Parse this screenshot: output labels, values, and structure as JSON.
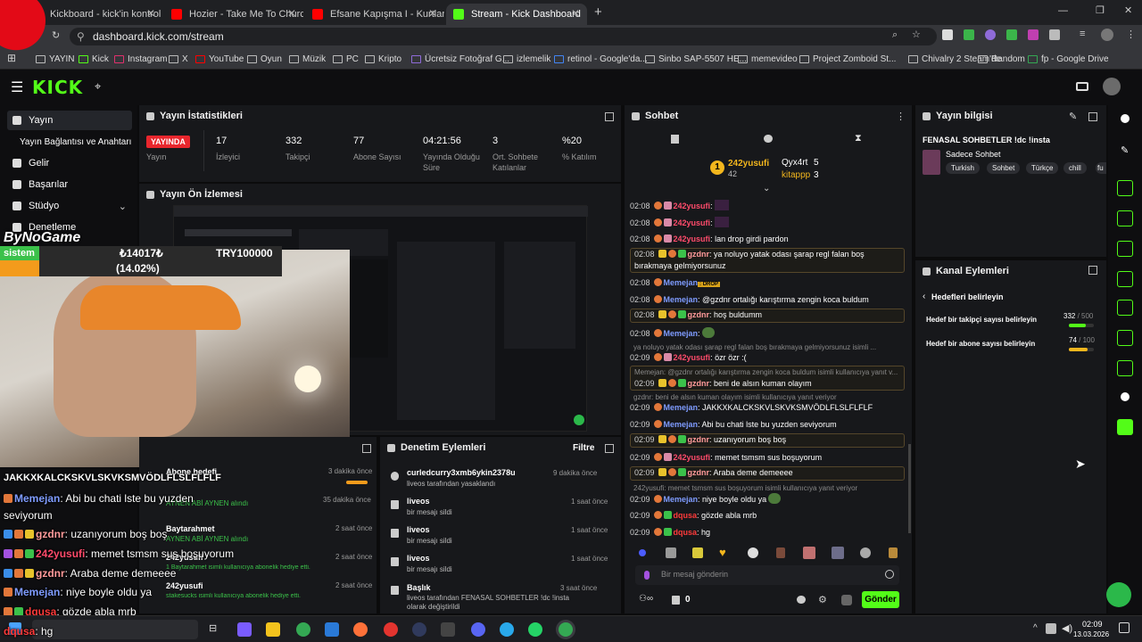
{
  "browser": {
    "tabs": [
      {
        "label": "Kickboard - kick'in kontrol pane",
        "color": "#53fc18"
      },
      {
        "label": "Hozier - Take Me To Church",
        "color": "#ff0000"
      },
      {
        "label": "Efsane Kapışma I - Kurtlar Vadisi",
        "color": "#ff0000"
      },
      {
        "label": "Stream - Kick Dashboard",
        "color": "#53fc18"
      }
    ],
    "url": "dashboard.kick.com/stream",
    "bookmarks": [
      "YAYIN",
      "Kick",
      "Instagram",
      "X",
      "YouTube",
      "Oyun",
      "Müzik",
      "PC",
      "Kripto",
      "Ücretsiz Fotoğraf G...",
      "izlemelik",
      "retinol - Google'da...",
      "Sinbo SAP-5507 HE...",
      "memevideo",
      "Project Zomboid St...",
      "Chivalry 2 Steam'de",
      "Random",
      "fp - Google Drive"
    ]
  },
  "app": {
    "logo": "KICK"
  },
  "sidebar": {
    "items": [
      {
        "label": "Yayın"
      },
      {
        "label": "Yayın Bağlantısı ve Anahtarı"
      },
      {
        "label": "Gelir"
      },
      {
        "label": "Başarılar"
      },
      {
        "label": "Stüdyo"
      },
      {
        "label": "Denetleme"
      }
    ]
  },
  "stats": {
    "title": "Yayın İstatistikleri",
    "live_badge": "YAYINDA",
    "live_label": "Yayın",
    "items": [
      {
        "value": "17",
        "label": "İzleyici"
      },
      {
        "value": "332",
        "label": "Takipçi"
      },
      {
        "value": "77",
        "label": "Abone Sayısı"
      },
      {
        "value": "04:21:56",
        "label": "Yayında Olduğu Süre"
      },
      {
        "value": "3",
        "label": "Ort. Sohbete Katılanlar"
      },
      {
        "value": "%20",
        "label": "% Katılım"
      }
    ]
  },
  "preview": {
    "title": "Yayın Ön İzlemesi"
  },
  "overlay": {
    "brand": "ByNoGame",
    "goal_label": "sistem",
    "goal_current": "₺14017₺",
    "goal_target": "TRY100000",
    "goal_percent": "(14.02%)",
    "goal_fraction": 0.1402,
    "lines": [
      {
        "user": "",
        "text": "JAKKXKALCKSKVLSKVKSMVÖDLFLSLFLFLF",
        "color": "#ffffff"
      },
      {
        "user": "Memejan",
        "text": ": Abi bu chati lste bu yuzden",
        "color": "#7f9cff"
      },
      {
        "user": "",
        "text": "seviyorum",
        "color": "#ffffff"
      },
      {
        "user": "gzdnr",
        "text": ": uzanıyorum boş boş",
        "color": "#ff9a9a"
      },
      {
        "user": "242yusufi",
        "text": ": memet tsmsm sus boşuyorum",
        "color": "#ff4b6b"
      },
      {
        "user": "gzdnr",
        "text": ": Araba deme demeeee",
        "color": "#ff9a9a"
      },
      {
        "user": "Memejan",
        "text": ": niye boyle oldu ya",
        "color": "#7f9cff"
      },
      {
        "user": "dqusa",
        "text": ": gözde abla mrb",
        "color": "#ff3a3a"
      },
      {
        "user": "dqusa",
        "text": ": hg",
        "color": "#ff3a3a"
      }
    ]
  },
  "activity": {
    "items": [
      {
        "title": "Abone hedefi",
        "sub": "",
        "time": "3 dakika önce"
      },
      {
        "title": "",
        "sub": "AYNEN ABİ AYNEN alındı",
        "time": "35 dakika önce"
      },
      {
        "title": "Baytarahmet",
        "sub": "AYNEN ABİ AYNEN alındı",
        "time": "2 saat önce"
      },
      {
        "title": "242yusufi",
        "sub": "1 Baytarahmet isimli kullanıcıya abonelik hediye etti.",
        "time": "2 saat önce"
      },
      {
        "title": "242yusufi",
        "sub": "stakesucks isimli kullanıcıya abonelik hediye etti.",
        "time": "2 saat önce"
      }
    ]
  },
  "moderation": {
    "title": "Denetim Eylemleri",
    "filter": "Filtre",
    "items": [
      {
        "user": "curledcurry3xmb6ykin2378u",
        "desc": "liveos tarafından yasaklandı",
        "time": "9 dakika önce"
      },
      {
        "user": "liveos",
        "desc": "bir mesajı sildi",
        "time": "1 saat önce"
      },
      {
        "user": "liveos",
        "desc": "bir mesajı sildi",
        "time": "1 saat önce"
      },
      {
        "user": "liveos",
        "desc": "bir mesajı sildi",
        "time": "1 saat önce"
      },
      {
        "user": "Başlık",
        "desc": "liveos tarafından FENASAL SOHBETLER !dc !insta olarak değiştirildi",
        "time": "3 saat önce"
      }
    ]
  },
  "chat": {
    "title": "Sohbet",
    "top": [
      {
        "rank": "1",
        "user": "242yusufi",
        "count": "42"
      },
      {
        "rank": "",
        "user": "Qyx4rt",
        "count": "5"
      },
      {
        "rank": "",
        "user": "kitappp",
        "count": "3"
      }
    ],
    "messages": [
      {
        "time": "02:08",
        "user": "242yusufi",
        "text": ":",
        "color": "#ff4b6b",
        "hl": false
      },
      {
        "time": "02:08",
        "user": "242yusufi",
        "text": ":",
        "color": "#ff4b6b",
        "hl": false
      },
      {
        "time": "02:08",
        "user": "242yusufi",
        "text": ": lan drop girdi pardon",
        "color": "#ff4b6b",
        "hl": false
      },
      {
        "time": "02:08",
        "user": "gzdnr",
        "text": ": ya noluyo yatak odası şarap regl falan boş bırakmaya gelmiyorsunuz",
        "color": "#ff9a9a",
        "hl": true
      },
      {
        "time": "02:08",
        "user": "Memejan",
        "text": ": DROP",
        "color": "#7f9cff",
        "hl": false
      },
      {
        "time": "02:08",
        "user": "Memejan",
        "text": ": @gzdnr ortalığı karıştırma zengin koca buldum",
        "color": "#7f9cff",
        "hl": false
      },
      {
        "time": "02:08",
        "user": "gzdnr",
        "text": ": hoş buldumm",
        "color": "#ff9a9a",
        "hl": true
      },
      {
        "time": "02:08",
        "user": "Memejan",
        "text": ":",
        "color": "#7f9cff",
        "hl": false
      },
      {
        "time": "02:09",
        "user": "242yusufi",
        "text": ": özr özr :(",
        "color": "#ff4b6b",
        "hl": false
      },
      {
        "time": "02:09",
        "user": "gzdnr",
        "text": ": beni de alsın kuman olayım",
        "color": "#ff9a9a",
        "hl": true
      },
      {
        "time": "02:09",
        "user": "Memejan",
        "text": ": JAKKXKALCKSKVLSKVKSMVÖDLFLSLFLFLF",
        "color": "#7f9cff",
        "hl": false
      },
      {
        "time": "02:09",
        "user": "Memejan",
        "text": ": Abi bu chati lste bu yuzden seviyorum",
        "color": "#7f9cff",
        "hl": false
      },
      {
        "time": "02:09",
        "user": "gzdnr",
        "text": ": uzanıyorum boş boş",
        "color": "#ff9a9a",
        "hl": true
      },
      {
        "time": "02:09",
        "user": "242yusufi",
        "text": ": memet tsmsm sus boşuyorum",
        "color": "#ff4b6b",
        "hl": false
      },
      {
        "time": "02:09",
        "user": "gzdnr",
        "text": ": Araba deme demeeee",
        "color": "#ff9a9a",
        "hl": true
      },
      {
        "time": "02:09",
        "user": "Memejan",
        "text": ": niye boyle oldu ya",
        "color": "#7f9cff",
        "hl": false
      },
      {
        "time": "02:09",
        "user": "dqusa",
        "text": ": gözde abla mrb",
        "color": "#ff3a3a",
        "hl": false
      },
      {
        "time": "02:09",
        "user": "dqusa",
        "text": ": hg",
        "color": "#ff3a3a",
        "hl": false
      }
    ],
    "replies": [
      "ya noluyo yatak odası şarap regl falan boş bırakmaya gelmiyorsunuz isimli ...",
      "Memejan: @gzdnr ortalığı karıştırma zengin koca buldum isimli kullanıcıya yanıt v...",
      "gzdnr: beni de alsın kuman olayım isimli kullanıcıya yanıt veriyor",
      "242yusufi: memet tsmsm sus boşuyorum isimli kullanıcıya yanıt veriyor"
    ],
    "placeholder": "Bir mesaj gönderin",
    "send": "Gönder",
    "users_count": "0"
  },
  "info": {
    "title": "Yayın bilgisi",
    "stream_title": "FENASAL SOHBETLER !dc !insta",
    "category": "Sadece Sohbet",
    "tags": [
      "Turkish",
      "Sohbet",
      "Türkçe",
      "chill",
      "fu"
    ]
  },
  "actions": {
    "title": "Kanal Eylemleri",
    "back": "Hedefleri belirleyin",
    "goals": [
      {
        "label": "Hedef bir takipçi sayısı belirleyin",
        "current": "332",
        "target": "500",
        "fraction": 0.664
      },
      {
        "label": "Hedef bir abone sayısı belirleyin",
        "current": "74",
        "target": "100",
        "fraction": 0.74
      }
    ]
  },
  "taskbar": {
    "clock_time": "02:09",
    "clock_date": "13.03.2026"
  }
}
